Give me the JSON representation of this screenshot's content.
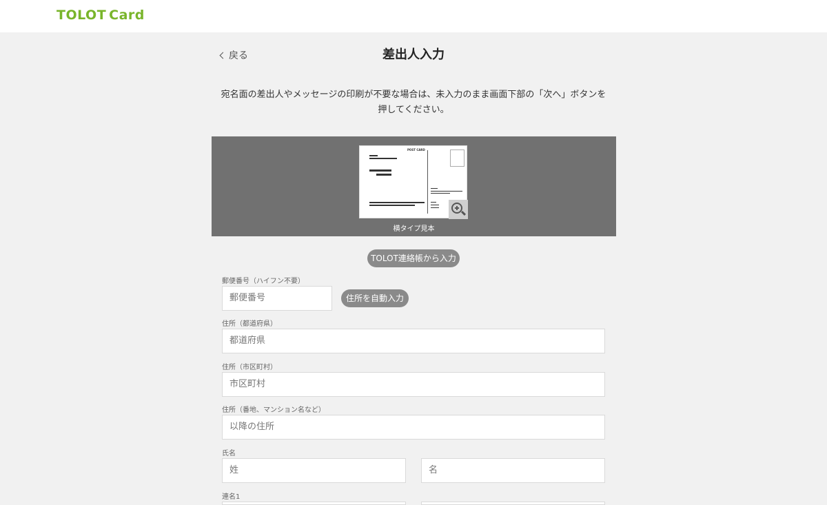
{
  "header": {
    "logo_main": "TOLOT",
    "logo_sub": "Card"
  },
  "nav": {
    "back_label": "戻る"
  },
  "page": {
    "title": "差出人入力",
    "notice": "宛名面の差出人やメッセージの印刷が不要な場合は、未入力のまま画面下部の「次へ」ボタンを押してください。"
  },
  "preview": {
    "caption": "横タイプ見本",
    "card_tag": "POST CARD"
  },
  "buttons": {
    "contacts": "TOLOT連絡帳から入力",
    "autofill": "住所を自動入力"
  },
  "form": {
    "postal_label": "郵便番号（ハイフン不要）",
    "postal_placeholder": "郵便番号",
    "pref_label": "住所（都道府県）",
    "pref_placeholder": "都道府県",
    "city_label": "住所（市区町村）",
    "city_placeholder": "市区町村",
    "addr_label": "住所（番地、マンション名など）",
    "addr_placeholder": "以降の住所",
    "name_label": "氏名",
    "last_placeholder": "姓",
    "first_placeholder": "名",
    "joint_label": "連名1"
  },
  "colors": {
    "brand": "#79b52b",
    "preview_bg": "#717171",
    "pill_bg": "#8a8a8a"
  }
}
